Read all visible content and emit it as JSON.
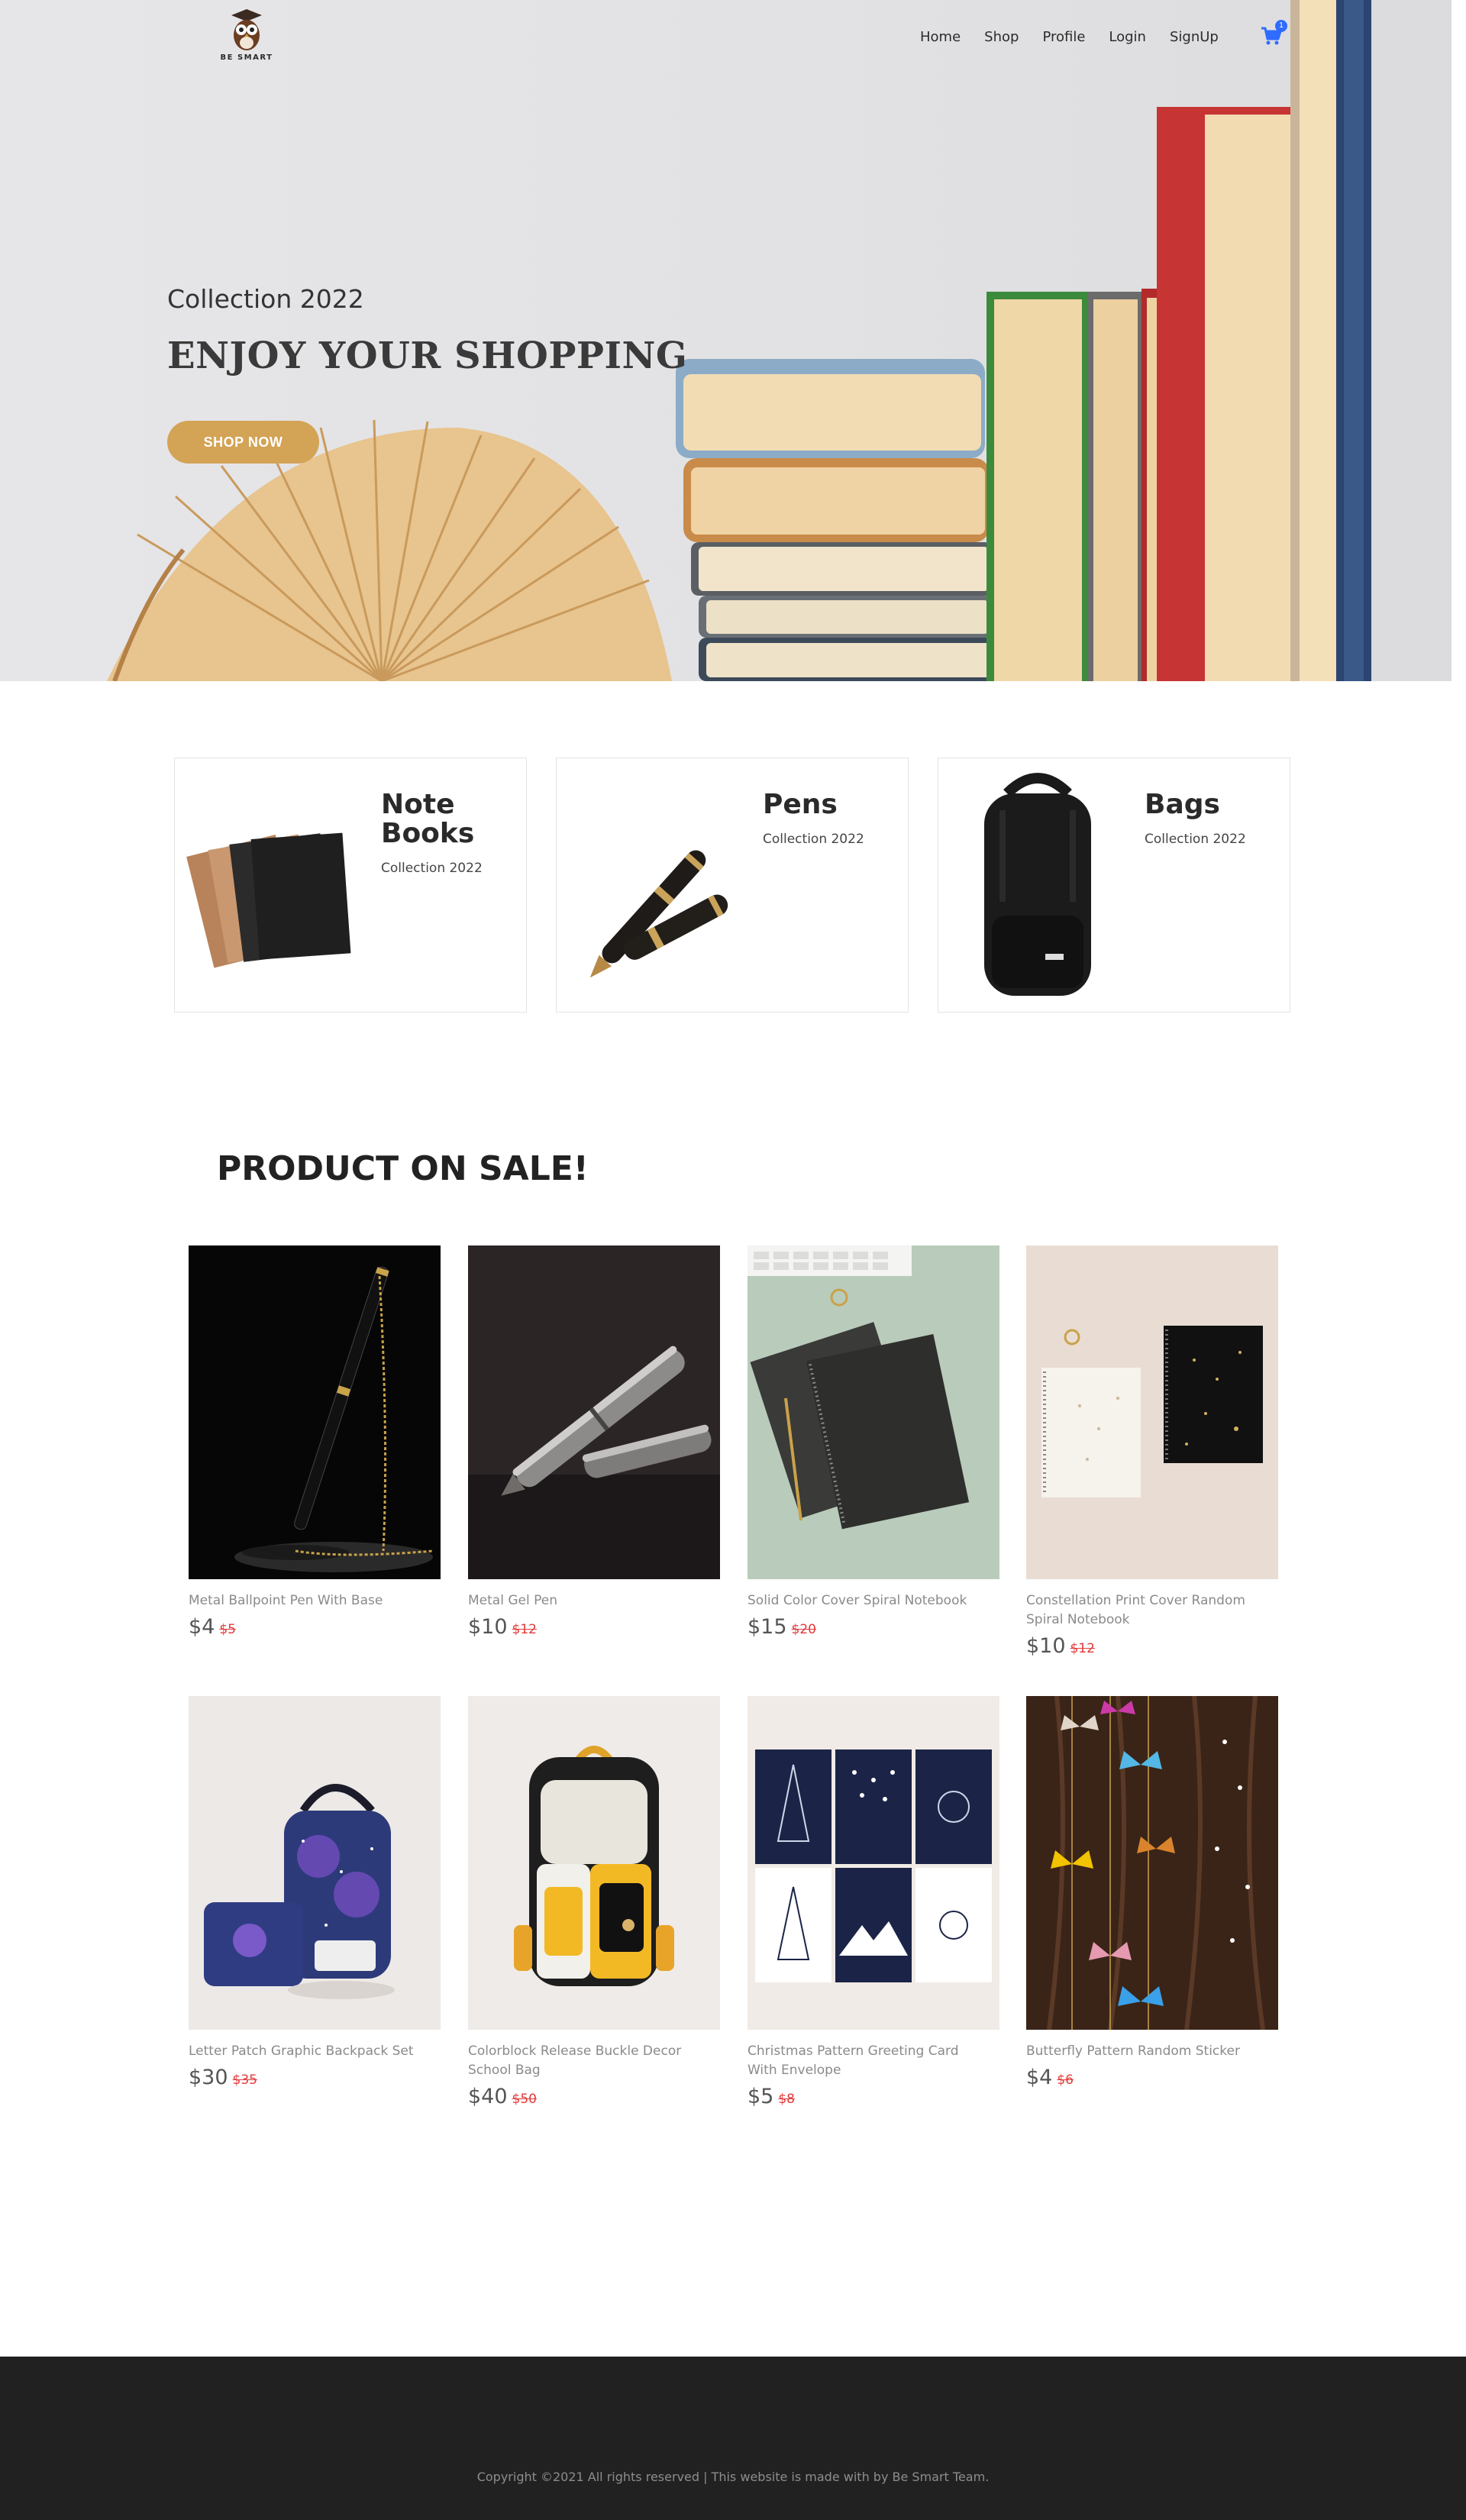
{
  "header": {
    "logo_text": "BE SMART",
    "nav": [
      "Home",
      "Shop",
      "Profile",
      "Login",
      "SignUp"
    ],
    "cart_count": "1",
    "cart_icon": "cart-icon"
  },
  "hero": {
    "subtitle": "Collection 2022",
    "title": "ENJOY YOUR SHOPPING",
    "button": "SHOP NOW"
  },
  "categories": [
    {
      "title": "Note Books",
      "subtitle": "Collection 2022"
    },
    {
      "title": "Pens",
      "subtitle": "Collection 2022"
    },
    {
      "title": "Bags",
      "subtitle": "Collection 2022"
    }
  ],
  "sale": {
    "title": "PRODUCT ON SALE!",
    "products": [
      {
        "name": "Metal Ballpoint Pen With Base",
        "price": "$4",
        "old_price": "$5"
      },
      {
        "name": "Metal Gel Pen",
        "price": "$10",
        "old_price": "$12"
      },
      {
        "name": "Solid Color Cover Spiral Notebook",
        "price": "$15",
        "old_price": "$20"
      },
      {
        "name": "Constellation Print Cover Random Spiral Notebook",
        "price": "$10",
        "old_price": "$12"
      },
      {
        "name": "Letter Patch Graphic Backpack Set",
        "price": "$30",
        "old_price": "$35"
      },
      {
        "name": "Colorblock Release Buckle Decor School Bag",
        "price": "$40",
        "old_price": "$50"
      },
      {
        "name": "Christmas Pattern Greeting Card With Envelope",
        "price": "$5",
        "old_price": "$8"
      },
      {
        "name": "Butterfly Pattern Random Sticker",
        "price": "$4",
        "old_price": "$6"
      }
    ]
  },
  "footer": {
    "copyright": "Copyright ©2021 All rights reserved | This website is made with  by Be Smart Team."
  },
  "colors": {
    "accent": "#d3a356",
    "sale_red": "#e23a3a",
    "footer_bg": "#212121",
    "cart_blue": "#2f6bff"
  }
}
